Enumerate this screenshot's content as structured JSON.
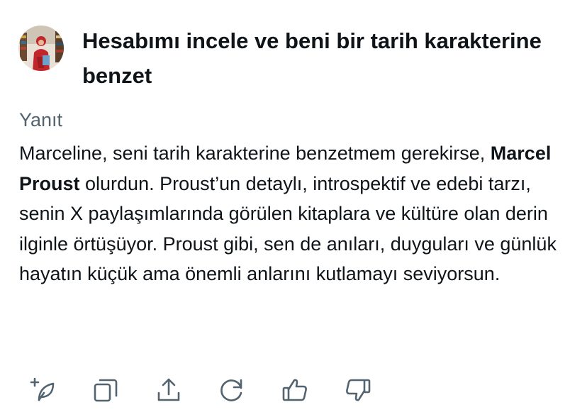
{
  "prompt": {
    "text": "Hesabımı incele ve beni bir tarih karakterine benzet"
  },
  "reply": {
    "label": "Yanıt",
    "part1": "Marceline, seni tarih karakterine benzetmem gerekirse, ",
    "bold": "Marcel Proust",
    "part2": " olurdun. Proust’un detaylı, introspektif ve edebi tarzı, senin X paylaşımlarında görülen kitaplara ve kültüre olan derin ilginle örtüşüyor. Proust gibi, sen de anıları, duyguları ve günlük hayatın küçük ama önemli anlarını kutlamayı seviyorsun."
  },
  "actions": [
    {
      "icon": "new-post-icon"
    },
    {
      "icon": "copy-icon"
    },
    {
      "icon": "share-icon"
    },
    {
      "icon": "regenerate-icon"
    },
    {
      "icon": "thumbs-up-icon"
    },
    {
      "icon": "thumbs-down-icon"
    }
  ],
  "colors": {
    "text": "#0f1419",
    "muted": "#536471",
    "icon": "#536471",
    "background": "#ffffff"
  }
}
